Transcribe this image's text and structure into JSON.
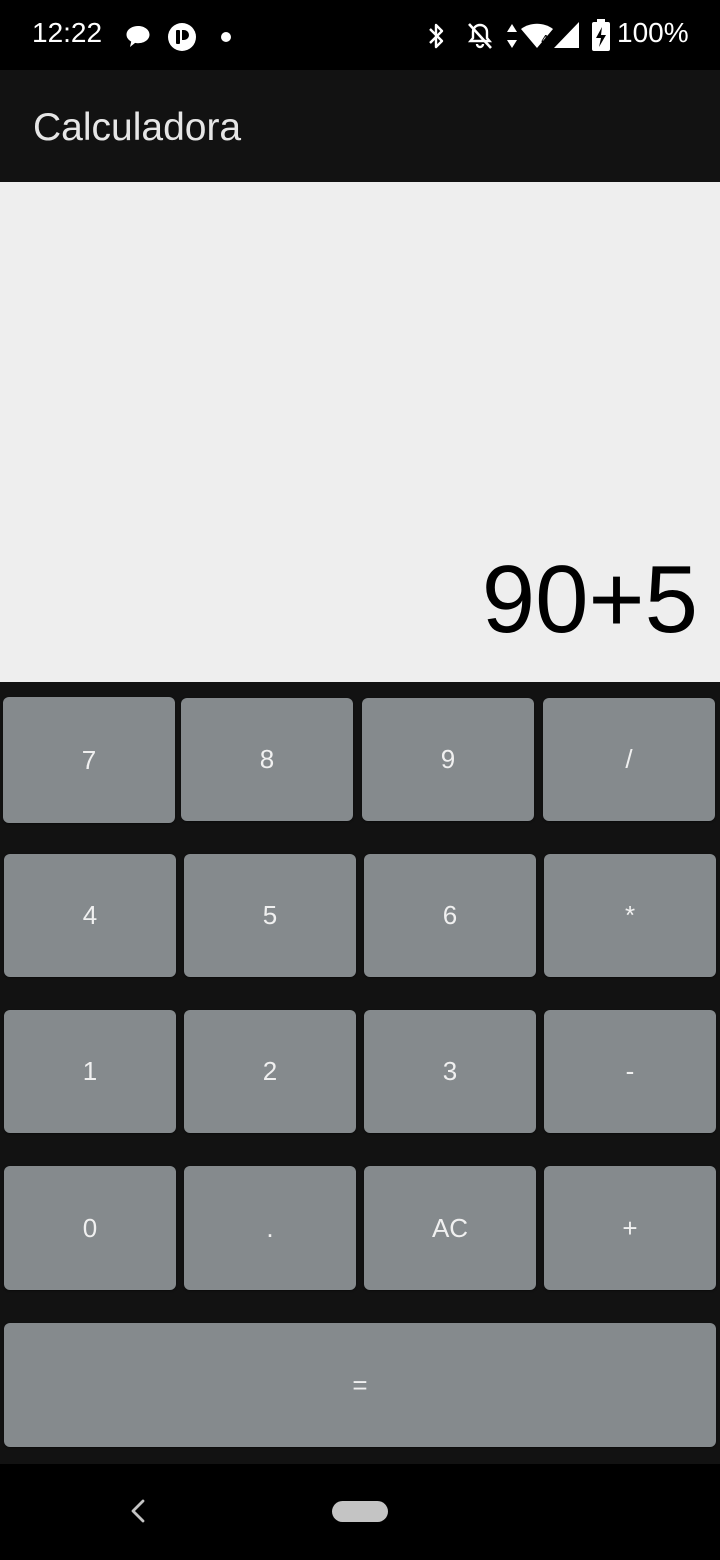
{
  "status_bar": {
    "time": "12:22",
    "battery": "100%",
    "icons": [
      "chat-icon",
      "pocket-casts-icon",
      "notification-dot-icon",
      "bluetooth-icon",
      "do-not-disturb-icon",
      "data-arrows-icon",
      "wifi-icon",
      "signal-icon",
      "battery-charging-icon"
    ]
  },
  "app_bar": {
    "title": "Calculadora"
  },
  "display": {
    "expression": "90+5"
  },
  "keypad": {
    "row1": [
      "7",
      "8",
      "9",
      "/"
    ],
    "row2": [
      "4",
      "5",
      "6",
      "*"
    ],
    "row3": [
      "1",
      "2",
      "3",
      "-"
    ],
    "row4": [
      "0",
      ".",
      "AC",
      "+"
    ],
    "equals": "="
  },
  "nav_bar": {
    "icons": [
      "back-icon",
      "home-pill-icon"
    ]
  },
  "colors": {
    "key_bg": "#858a8d",
    "keypad_bg": "#121212",
    "display_bg": "#eeeeee",
    "app_bar_bg": "#121212"
  }
}
